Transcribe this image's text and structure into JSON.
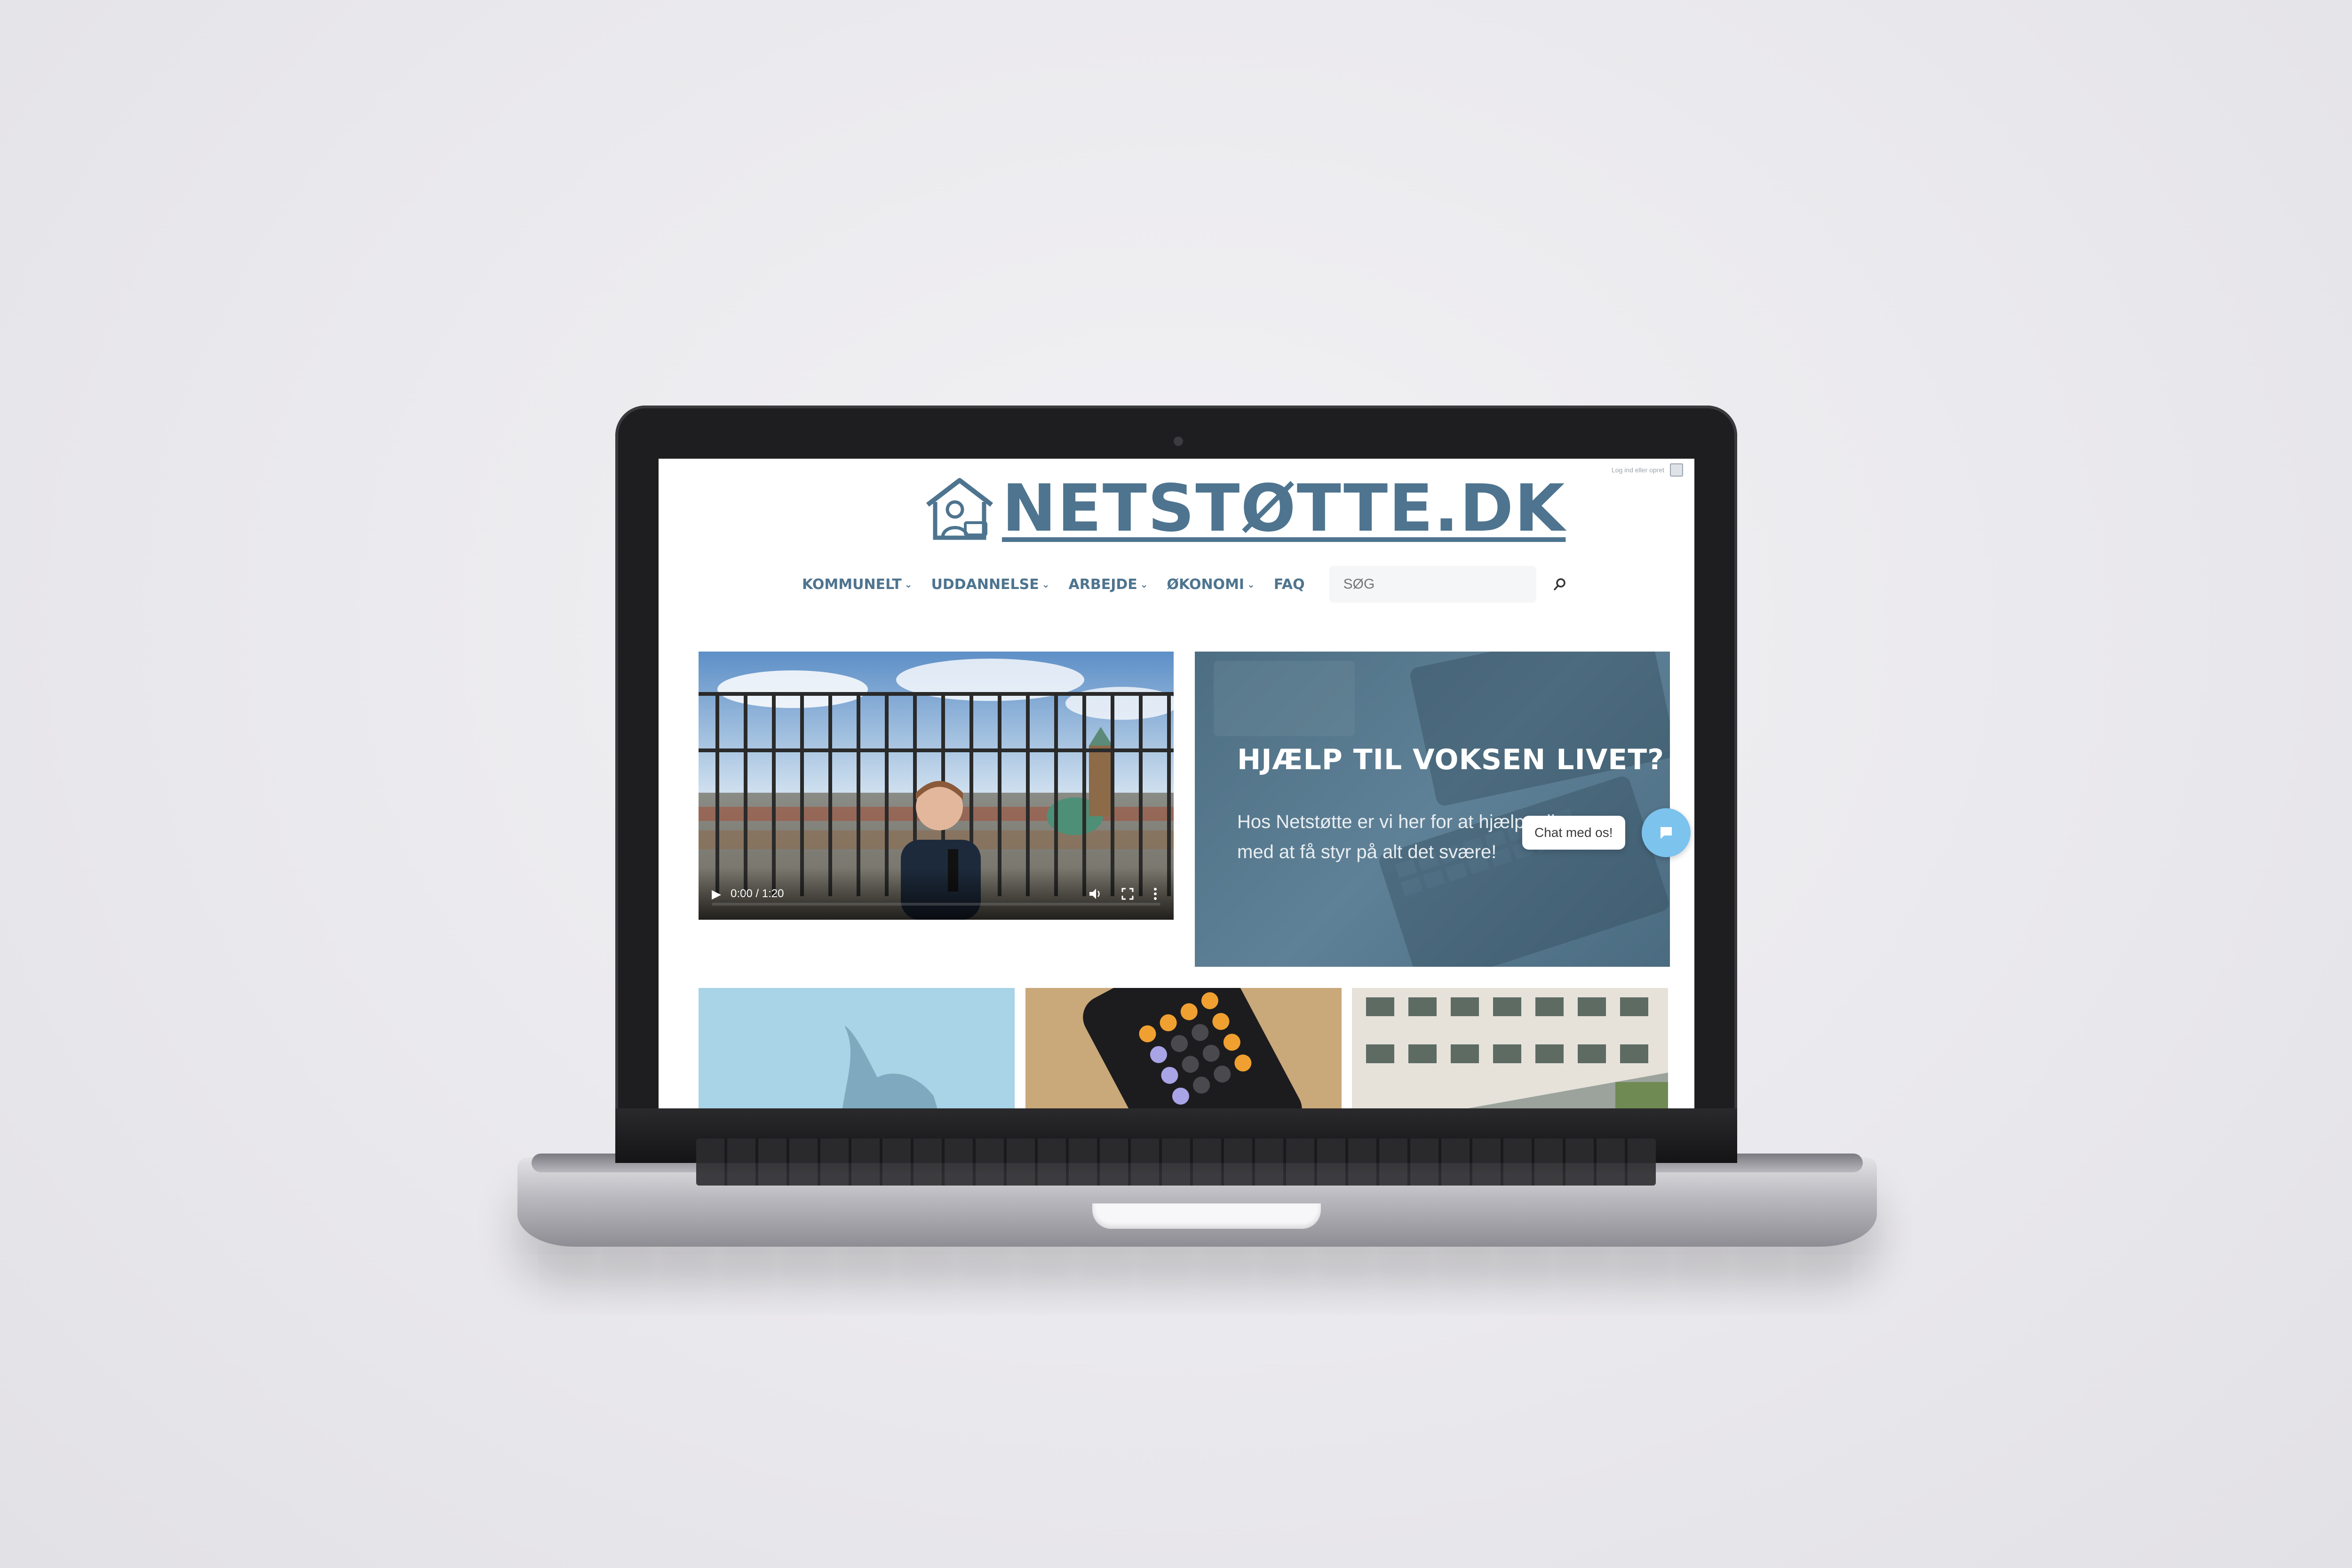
{
  "site": {
    "name": "NETSTØTTE.DK",
    "brand_color": "#4e748f",
    "login_text": "Log ind eller opret"
  },
  "nav": {
    "items": [
      {
        "label": "KOMMUNELT",
        "has_dropdown": true
      },
      {
        "label": "UDDANNELSE",
        "has_dropdown": true
      },
      {
        "label": "ARBEJDE",
        "has_dropdown": true
      },
      {
        "label": "ØKONOMI",
        "has_dropdown": true
      },
      {
        "label": "FAQ",
        "has_dropdown": false
      }
    ],
    "search_placeholder": "SØG",
    "search_icon": "search-icon"
  },
  "video": {
    "time": "0:00 / 1:20",
    "progress": 0.0,
    "icons": [
      "play-icon",
      "volume-icon",
      "fullscreen-icon",
      "more-icon"
    ]
  },
  "hero": {
    "title": "HJÆLP TIL VOKSEN LIVET?",
    "text": "Hos Netstøtte er vi her for at hjælpe dig, med at få styr på alt det svære!"
  },
  "chat": {
    "label": "Chat med os!",
    "icon": "chat-icon",
    "color": "#7cc3ee"
  },
  "cards": [
    {
      "image": "hand-photo"
    },
    {
      "image": "calculator-photo"
    },
    {
      "image": "building-photo"
    }
  ]
}
